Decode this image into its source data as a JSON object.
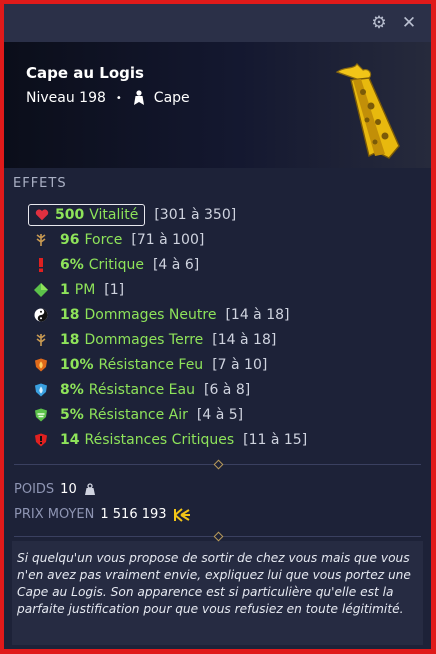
{
  "item": {
    "name": "Cape au Logis",
    "level": "Niveau 198",
    "type": "Cape"
  },
  "section": "EFFETS",
  "effects": [
    {
      "value": "500",
      "name": "Vitalité",
      "range": "[301 à 350]",
      "icon": "heart-icon",
      "color": "#e03040"
    },
    {
      "value": "96",
      "name": "Force",
      "range": "[71 à 100]",
      "icon": "force-icon",
      "color": "#c89a52"
    },
    {
      "value": "6%",
      "name": "Critique",
      "range": "[4 à 6]",
      "icon": "critical-icon",
      "color": "#e02020"
    },
    {
      "value": "1",
      "name": "PM",
      "range": "[1]",
      "icon": "pm-icon",
      "color": "#5cc24a"
    },
    {
      "value": "18",
      "name": "Dommages Neutre",
      "range": "[14 à 18]",
      "icon": "neutral-icon",
      "color": "#e8e8e8"
    },
    {
      "value": "18",
      "name": "Dommages Terre",
      "range": "[14 à 18]",
      "icon": "earth-icon",
      "color": "#c89a52"
    },
    {
      "value": "10%",
      "name": "Résistance Feu",
      "range": "[7 à 10]",
      "icon": "fire-shield-icon",
      "color": "#e06a1a"
    },
    {
      "value": "8%",
      "name": "Résistance Eau",
      "range": "[6 à 8]",
      "icon": "water-shield-icon",
      "color": "#3aa0e0"
    },
    {
      "value": "5%",
      "name": "Résistance Air",
      "range": "[4 à 5]",
      "icon": "air-shield-icon",
      "color": "#5cc24a"
    },
    {
      "value": "14",
      "name": "Résistances Critiques",
      "range": "[11 à 15]",
      "icon": "crit-shield-icon",
      "color": "#e02020"
    }
  ],
  "meta": {
    "weight_label": "POIDS",
    "weight_value": "10",
    "price_label": "PRIX MOYEN",
    "price_value": "1 516 193"
  },
  "description": "Si quelqu'un vous propose de sortir de chez vous mais que vous n'en avez pas vraiment envie, expliquez lui que vous portez une Cape au Logis. Son apparence est si particulière qu'elle est la parfaite justification pour que vous refusiez en toute légitimité."
}
